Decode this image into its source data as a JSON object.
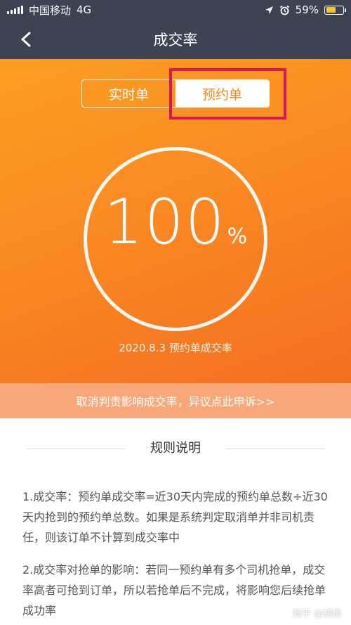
{
  "status_bar": {
    "carrier": "中国移动",
    "network": "4G",
    "battery": "59%",
    "battery_level": 0.59,
    "icons": [
      "signal-icon",
      "location-arrow-icon",
      "alarm-icon",
      "battery-icon"
    ]
  },
  "nav": {
    "title": "成交率",
    "back_icon": "chevron-left-icon"
  },
  "tabs": [
    {
      "label": "实时单",
      "selected": false
    },
    {
      "label": "预约单",
      "selected": true
    }
  ],
  "rate": {
    "value": "100",
    "unit": "%",
    "caption": "2020.8.3 预约单成交率"
  },
  "appeal": {
    "text": "取消判责影响成交率，异议点此申诉>>"
  },
  "rules": {
    "title": "规则说明",
    "items": [
      "1.成交率：预约单成交率=近30天内完成的预约单总数÷近30天内抢到的预约单总数。如果是系统判定取消单并非司机责任，则该订单不计算到成交率中",
      "2.成交率对抢单的影响：若同一预约单有多个司机抢单，成交率高者可抢到订单，所以若抢单后不完成，将影响您后续抢单成功率"
    ]
  },
  "watermark": "知乎 @胡杨",
  "colors": {
    "nav_bg": "#3d4353",
    "hero_orange": "#fa8a22",
    "highlight_border": "#d8175b",
    "battery_fill": "#f5c629"
  }
}
